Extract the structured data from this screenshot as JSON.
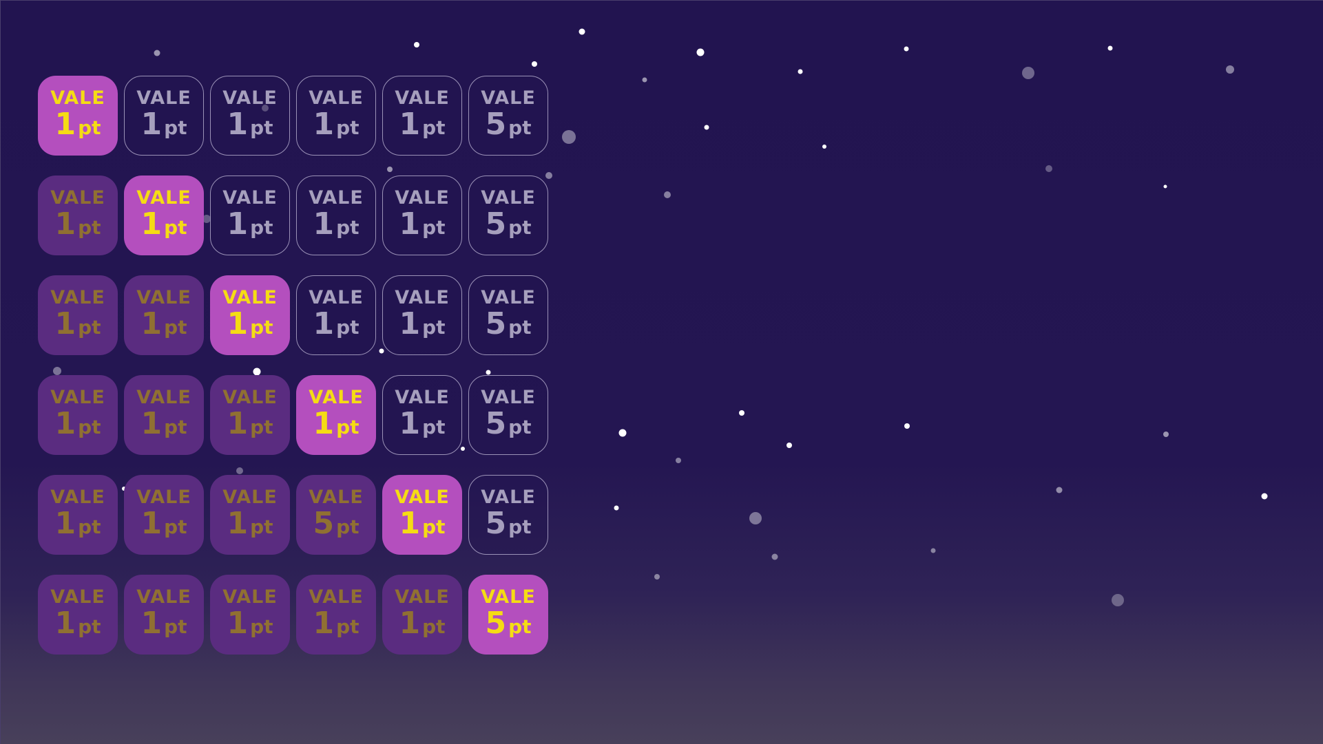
{
  "board": {
    "rows": [
      [
        {
          "label": "VALE",
          "value": "1",
          "unit": "pt",
          "state": "current"
        },
        {
          "label": "VALE",
          "value": "1",
          "unit": "pt",
          "state": "future"
        },
        {
          "label": "VALE",
          "value": "1",
          "unit": "pt",
          "state": "future"
        },
        {
          "label": "VALE",
          "value": "1",
          "unit": "pt",
          "state": "future"
        },
        {
          "label": "VALE",
          "value": "1",
          "unit": "pt",
          "state": "future"
        },
        {
          "label": "VALE",
          "value": "5",
          "unit": "pt",
          "state": "future"
        }
      ],
      [
        {
          "label": "VALE",
          "value": "1",
          "unit": "pt",
          "state": "past"
        },
        {
          "label": "VALE",
          "value": "1",
          "unit": "pt",
          "state": "current"
        },
        {
          "label": "VALE",
          "value": "1",
          "unit": "pt",
          "state": "future"
        },
        {
          "label": "VALE",
          "value": "1",
          "unit": "pt",
          "state": "future"
        },
        {
          "label": "VALE",
          "value": "1",
          "unit": "pt",
          "state": "future"
        },
        {
          "label": "VALE",
          "value": "5",
          "unit": "pt",
          "state": "future"
        }
      ],
      [
        {
          "label": "VALE",
          "value": "1",
          "unit": "pt",
          "state": "past"
        },
        {
          "label": "VALE",
          "value": "1",
          "unit": "pt",
          "state": "past"
        },
        {
          "label": "VALE",
          "value": "1",
          "unit": "pt",
          "state": "current"
        },
        {
          "label": "VALE",
          "value": "1",
          "unit": "pt",
          "state": "future"
        },
        {
          "label": "VALE",
          "value": "1",
          "unit": "pt",
          "state": "future"
        },
        {
          "label": "VALE",
          "value": "5",
          "unit": "pt",
          "state": "future"
        }
      ],
      [
        {
          "label": "VALE",
          "value": "1",
          "unit": "pt",
          "state": "past"
        },
        {
          "label": "VALE",
          "value": "1",
          "unit": "pt",
          "state": "past"
        },
        {
          "label": "VALE",
          "value": "1",
          "unit": "pt",
          "state": "past"
        },
        {
          "label": "VALE",
          "value": "1",
          "unit": "pt",
          "state": "current"
        },
        {
          "label": "VALE",
          "value": "1",
          "unit": "pt",
          "state": "future"
        },
        {
          "label": "VALE",
          "value": "5",
          "unit": "pt",
          "state": "future"
        }
      ],
      [
        {
          "label": "VALE",
          "value": "1",
          "unit": "pt",
          "state": "past"
        },
        {
          "label": "VALE",
          "value": "1",
          "unit": "pt",
          "state": "past"
        },
        {
          "label": "VALE",
          "value": "1",
          "unit": "pt",
          "state": "past"
        },
        {
          "label": "VALE",
          "value": "5",
          "unit": "pt",
          "state": "past"
        },
        {
          "label": "VALE",
          "value": "1",
          "unit": "pt",
          "state": "current"
        },
        {
          "label": "VALE",
          "value": "5",
          "unit": "pt",
          "state": "future"
        }
      ],
      [
        {
          "label": "VALE",
          "value": "1",
          "unit": "pt",
          "state": "past"
        },
        {
          "label": "VALE",
          "value": "1",
          "unit": "pt",
          "state": "past"
        },
        {
          "label": "VALE",
          "value": "1",
          "unit": "pt",
          "state": "past"
        },
        {
          "label": "VALE",
          "value": "1",
          "unit": "pt",
          "state": "past"
        },
        {
          "label": "VALE",
          "value": "1",
          "unit": "pt",
          "state": "past"
        },
        {
          "label": "VALE",
          "value": "5",
          "unit": "pt",
          "state": "current"
        }
      ]
    ]
  },
  "colors": {
    "background_top": "#221450",
    "background_bottom": "#48405a",
    "current_tile": "#b44fbe",
    "current_text": "#f5dc14",
    "past_tile": "#5a2c80",
    "past_text": "#907032",
    "future_border": "#9c93b8",
    "future_text": "#a69fbd",
    "star": "#ffffff"
  }
}
